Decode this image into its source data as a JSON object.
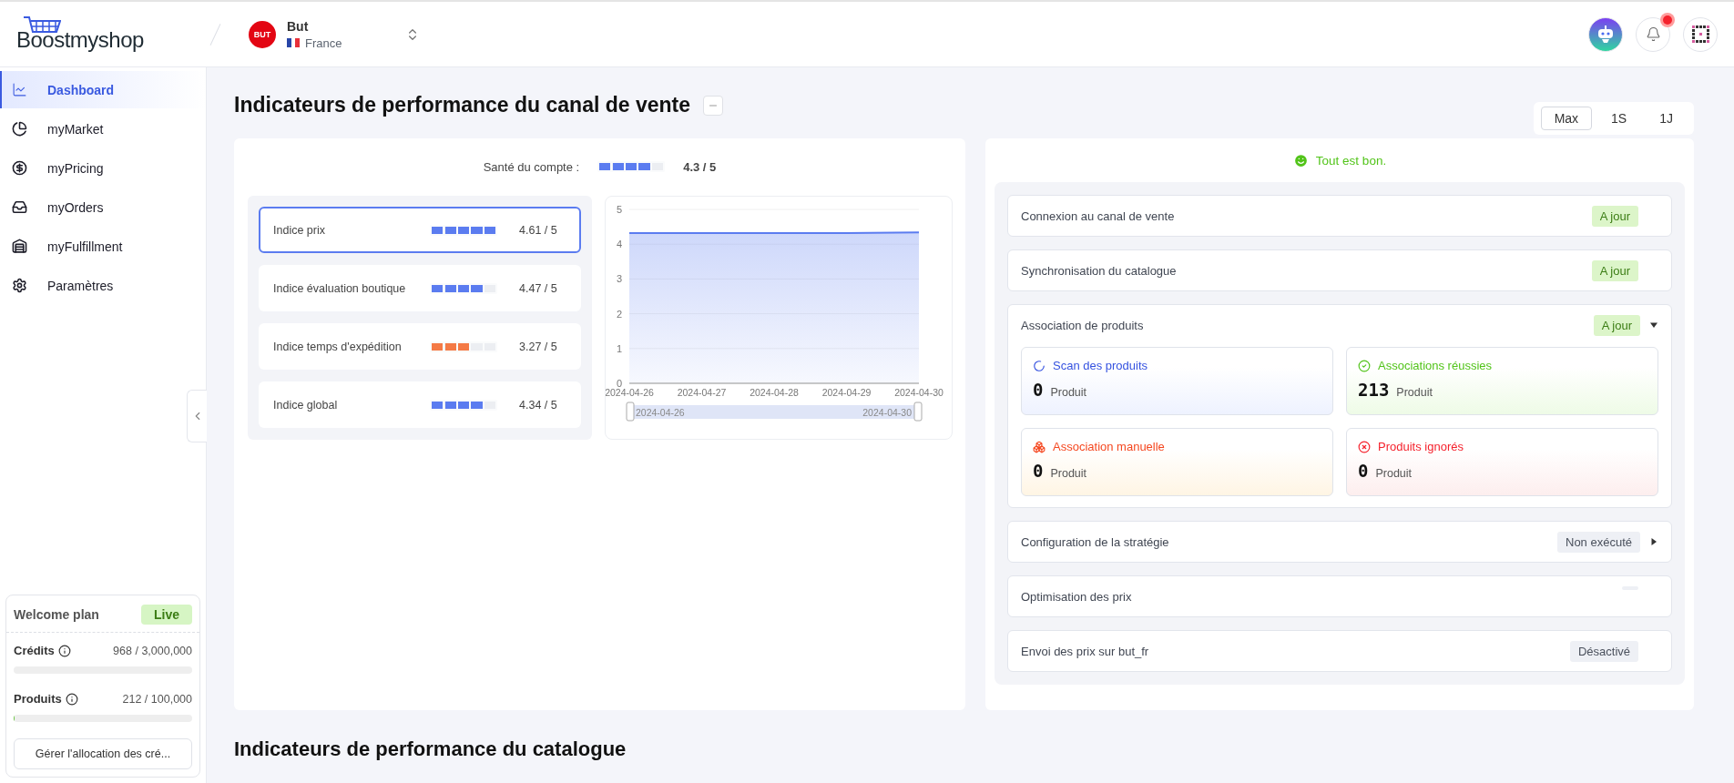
{
  "header": {
    "logo": "Boostmyshop",
    "store": {
      "badge": "BUT",
      "name": "But",
      "country": "France"
    }
  },
  "sidebar": {
    "items": [
      {
        "label": "Dashboard",
        "selected": true
      },
      {
        "label": "myMarket",
        "selected": false
      },
      {
        "label": "myPricing",
        "selected": false
      },
      {
        "label": "myOrders",
        "selected": false
      },
      {
        "label": "myFulfillment",
        "selected": false
      },
      {
        "label": "Paramètres",
        "selected": false
      }
    ],
    "plan": {
      "name": "Welcome plan",
      "badge": "Live",
      "metrics": [
        {
          "label": "Crédits",
          "reading": "968 / 3,000,000",
          "level": 0.0003
        },
        {
          "label": "Produits",
          "reading": "212 / 100,000",
          "level": 0.006
        }
      ],
      "button": "Gérer l'allocation des cré..."
    }
  },
  "section": {
    "title": "Indicateurs de performance du canal de vente",
    "periods": [
      {
        "label": "Max",
        "selected": true
      },
      {
        "label": "1S",
        "selected": false
      },
      {
        "label": "1J",
        "selected": false
      }
    ]
  },
  "health": {
    "label": "Santé du compte :",
    "level": 0.8,
    "score": "4.3 / 5"
  },
  "indices": [
    {
      "label": "Indice prix",
      "level": 1,
      "color": "#5b7cf0",
      "score": "4.61 / 5",
      "selected": true
    },
    {
      "label": "Indice évaluation boutique",
      "level": 0.8,
      "color": "#5b7cf0",
      "score": "4.47 / 5",
      "selected": false
    },
    {
      "label": "Indice temps d'expédition",
      "level": 0.6,
      "color": "#f47a45",
      "score": "3.27 / 5",
      "selected": false
    },
    {
      "label": "Indice global",
      "level": 0.8,
      "color": "#5b7cf0",
      "score": "4.34 / 5",
      "selected": false
    }
  ],
  "chart_data": {
    "type": "area",
    "categories": [
      "2024-04-26",
      "2024-04-27",
      "2024-04-28",
      "2024-04-29",
      "2024-04-30"
    ],
    "grid": true,
    "series": [
      {
        "color": "#5b7cf0",
        "values": [
          4.32,
          4.32,
          4.32,
          4.32,
          4.34
        ]
      }
    ],
    "ylim": [
      0,
      5
    ],
    "yticks": [
      0,
      1,
      2,
      3,
      4,
      5
    ]
  },
  "range_slider": {
    "start": "2024-04-26",
    "end": "2024-04-30"
  },
  "status": {
    "message": "Tout est bon.",
    "rows": [
      {
        "label": "Connexion au canal de vente",
        "status": {
          "kind": "ok",
          "text": "A jour"
        }
      },
      {
        "label": "Synchronisation du catalogue",
        "status": {
          "kind": "ok",
          "text": "A jour"
        }
      },
      {
        "label": "Association de produits",
        "status": {
          "kind": "ok",
          "text": "A jour"
        },
        "expanded": true,
        "tiles": [
          {
            "kind": "scan",
            "label": "Scan des produits",
            "count": "0",
            "unit": "Produit"
          },
          {
            "kind": "success",
            "label": "Associations réussies",
            "count": "213",
            "unit": "Produit"
          },
          {
            "kind": "manual",
            "label": "Association manuelle",
            "count": "0",
            "unit": "Produit"
          },
          {
            "kind": "ignored",
            "label": "Produits ignorés",
            "count": "0",
            "unit": "Produit"
          }
        ]
      },
      {
        "label": "Configuration de la stratégie",
        "status": {
          "kind": "neutral",
          "text": "Non exécuté"
        },
        "expanded": false
      },
      {
        "label": "Optimisation des prix",
        "status": {
          "kind": "pending"
        }
      },
      {
        "label": "Envoi des prix sur but_fr",
        "status": {
          "kind": "neutral",
          "text": "Désactivé"
        }
      }
    ]
  },
  "next_section": {
    "title": "Indicateurs de performance du catalogue"
  }
}
